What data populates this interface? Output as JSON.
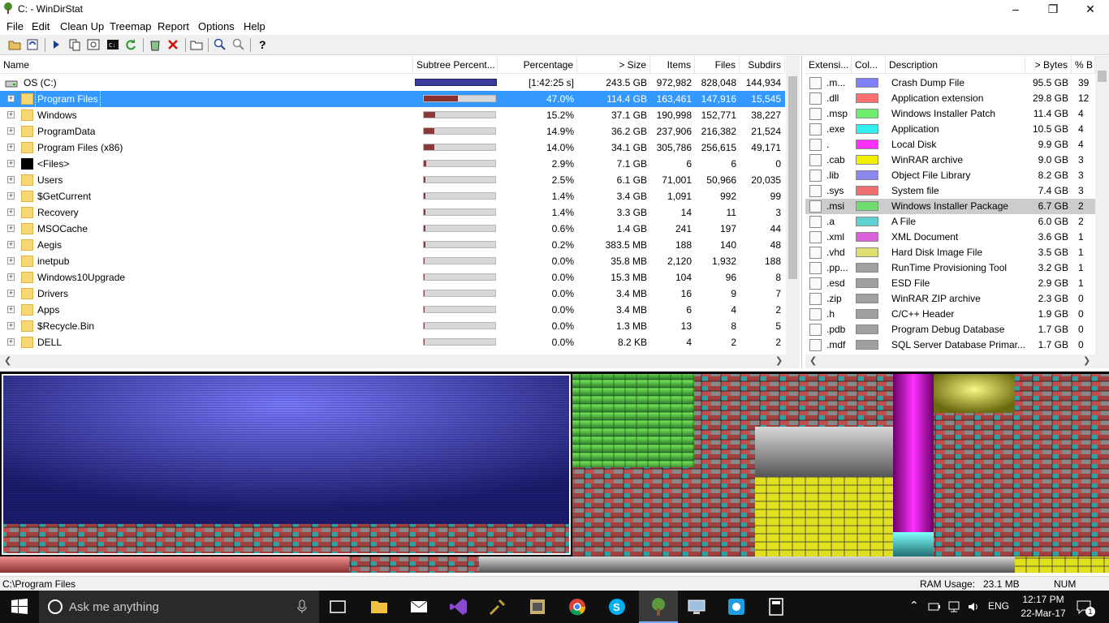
{
  "window": {
    "title": "C: - WinDirStat"
  },
  "menu": [
    "File",
    "Edit",
    "Clean Up",
    "Treemap",
    "Report",
    "Options",
    "Help"
  ],
  "tree": {
    "columns": [
      "Name",
      "Subtree Percent...",
      "Percentage",
      "> Size",
      "Items",
      "Files",
      "Subdirs"
    ],
    "root": {
      "name": "OS (C:)",
      "subtree": 1.0,
      "percentage": "[1:42:25 s]",
      "size": "243.5 GB",
      "items": "972,982",
      "files": "828,048",
      "subdirs": "144,934"
    },
    "rows": [
      {
        "name": "Program Files",
        "subtree": 0.47,
        "percentage": "47.0%",
        "size": "114.4 GB",
        "items": "163,461",
        "files": "147,916",
        "subdirs": "15,545",
        "selected": true
      },
      {
        "name": "Windows",
        "subtree": 0.152,
        "percentage": "15.2%",
        "size": "37.1 GB",
        "items": "190,998",
        "files": "152,771",
        "subdirs": "38,227"
      },
      {
        "name": "ProgramData",
        "subtree": 0.149,
        "percentage": "14.9%",
        "size": "36.2 GB",
        "items": "237,906",
        "files": "216,382",
        "subdirs": "21,524"
      },
      {
        "name": "Program Files (x86)",
        "subtree": 0.14,
        "percentage": "14.0%",
        "size": "34.1 GB",
        "items": "305,786",
        "files": "256,615",
        "subdirs": "49,171"
      },
      {
        "name": "<Files>",
        "subtree": 0.029,
        "percentage": "2.9%",
        "size": "7.1 GB",
        "items": "6",
        "files": "6",
        "subdirs": "0",
        "black": true
      },
      {
        "name": "Users",
        "subtree": 0.025,
        "percentage": "2.5%",
        "size": "6.1 GB",
        "items": "71,001",
        "files": "50,966",
        "subdirs": "20,035"
      },
      {
        "name": "$GetCurrent",
        "subtree": 0.014,
        "percentage": "1.4%",
        "size": "3.4 GB",
        "items": "1,091",
        "files": "992",
        "subdirs": "99"
      },
      {
        "name": "Recovery",
        "subtree": 0.014,
        "percentage": "1.4%",
        "size": "3.3 GB",
        "items": "14",
        "files": "11",
        "subdirs": "3"
      },
      {
        "name": "MSOCache",
        "subtree": 0.006,
        "percentage": "0.6%",
        "size": "1.4 GB",
        "items": "241",
        "files": "197",
        "subdirs": "44"
      },
      {
        "name": "Aegis",
        "subtree": 0.002,
        "percentage": "0.2%",
        "size": "383.5 MB",
        "items": "188",
        "files": "140",
        "subdirs": "48"
      },
      {
        "name": "inetpub",
        "subtree": 0.0,
        "percentage": "0.0%",
        "size": "35.8 MB",
        "items": "2,120",
        "files": "1,932",
        "subdirs": "188"
      },
      {
        "name": "Windows10Upgrade",
        "subtree": 0.0,
        "percentage": "0.0%",
        "size": "15.3 MB",
        "items": "104",
        "files": "96",
        "subdirs": "8"
      },
      {
        "name": "Drivers",
        "subtree": 0.0,
        "percentage": "0.0%",
        "size": "3.4 MB",
        "items": "16",
        "files": "9",
        "subdirs": "7"
      },
      {
        "name": "Apps",
        "subtree": 0.0,
        "percentage": "0.0%",
        "size": "3.4 MB",
        "items": "6",
        "files": "4",
        "subdirs": "2"
      },
      {
        "name": "$Recycle.Bin",
        "subtree": 0.0,
        "percentage": "0.0%",
        "size": "1.3 MB",
        "items": "13",
        "files": "8",
        "subdirs": "5"
      },
      {
        "name": "DELL",
        "subtree": 0.0,
        "percentage": "0.0%",
        "size": "8.2 KB",
        "items": "4",
        "files": "2",
        "subdirs": "2"
      }
    ]
  },
  "extensions": {
    "columns": [
      "Extensi...",
      "Col...",
      "Description",
      "> Bytes",
      "% B"
    ],
    "rows": [
      {
        "ext": ".m...",
        "color": "#8080ff",
        "desc": "Crash Dump File",
        "bytes": "95.5 GB",
        "pct": "39"
      },
      {
        "ext": ".dll",
        "color": "#ff7070",
        "desc": "Application extension",
        "bytes": "29.8 GB",
        "pct": "12"
      },
      {
        "ext": ".msp",
        "color": "#70ee70",
        "desc": "Windows Installer Patch",
        "bytes": "11.4 GB",
        "pct": "4"
      },
      {
        "ext": ".exe",
        "color": "#30f0f0",
        "desc": "Application",
        "bytes": "10.5 GB",
        "pct": "4"
      },
      {
        "ext": ".",
        "color": "#ff30ff",
        "desc": "Local Disk",
        "bytes": "9.9 GB",
        "pct": "4"
      },
      {
        "ext": ".cab",
        "color": "#f0f000",
        "desc": "WinRAR archive",
        "bytes": "9.0 GB",
        "pct": "3"
      },
      {
        "ext": ".lib",
        "color": "#8888ee",
        "desc": "Object File Library",
        "bytes": "8.2 GB",
        "pct": "3"
      },
      {
        "ext": ".sys",
        "color": "#ee7070",
        "desc": "System file",
        "bytes": "7.4 GB",
        "pct": "3"
      },
      {
        "ext": ".msi",
        "color": "#70dd70",
        "desc": "Windows Installer Package",
        "bytes": "6.7 GB",
        "pct": "2",
        "selected": true
      },
      {
        "ext": ".a",
        "color": "#60d0d0",
        "desc": "A File",
        "bytes": "6.0 GB",
        "pct": "2"
      },
      {
        "ext": ".xml",
        "color": "#dd60dd",
        "desc": "XML Document",
        "bytes": "3.6 GB",
        "pct": "1"
      },
      {
        "ext": ".vhd",
        "color": "#dddd70",
        "desc": "Hard Disk Image File",
        "bytes": "3.5 GB",
        "pct": "1"
      },
      {
        "ext": ".pp...",
        "color": "#a0a0a0",
        "desc": "RunTime Provisioning Tool",
        "bytes": "3.2 GB",
        "pct": "1"
      },
      {
        "ext": ".esd",
        "color": "#a0a0a0",
        "desc": "ESD File",
        "bytes": "2.9 GB",
        "pct": "1"
      },
      {
        "ext": ".zip",
        "color": "#a0a0a0",
        "desc": "WinRAR ZIP archive",
        "bytes": "2.3 GB",
        "pct": "0"
      },
      {
        "ext": ".h",
        "color": "#a0a0a0",
        "desc": "C/C++ Header",
        "bytes": "1.9 GB",
        "pct": "0"
      },
      {
        "ext": ".pdb",
        "color": "#a0a0a0",
        "desc": "Program Debug Database",
        "bytes": "1.7 GB",
        "pct": "0"
      },
      {
        "ext": ".mdf",
        "color": "#a0a0a0",
        "desc": "SQL Server Database Primar...",
        "bytes": "1.7 GB",
        "pct": "0"
      }
    ]
  },
  "status": {
    "path": "C:\\Program Files",
    "ram_label": "RAM Usage:",
    "ram": "23.1 MB",
    "num": "NUM"
  },
  "taskbar": {
    "search": "Ask me anything",
    "lang": "ENG",
    "time": "12:17 PM",
    "date": "22-Mar-17",
    "notif": "1"
  }
}
